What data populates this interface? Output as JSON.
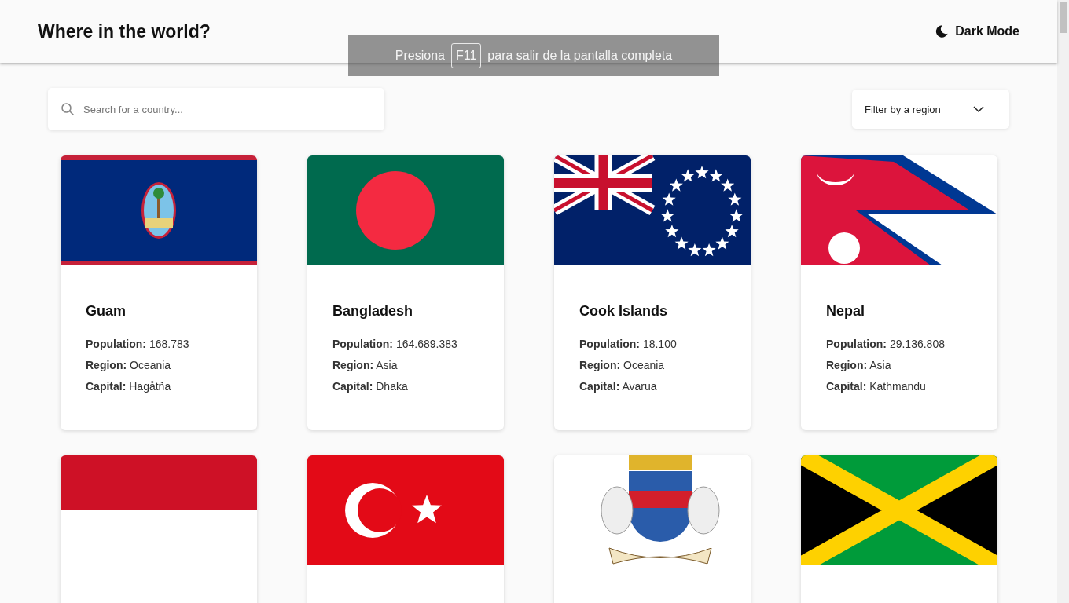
{
  "header": {
    "title": "Where in the world?",
    "theme_toggle": "Dark Mode"
  },
  "fullscreen_notice": {
    "before": "Presiona",
    "key": "F11",
    "after": "para salir de la pantalla completa"
  },
  "search": {
    "placeholder": "Search for a country..."
  },
  "region_filter": {
    "label": "Filter by a region"
  },
  "countries": [
    {
      "kind": "guam",
      "name": "Guam",
      "fields": [
        {
          "label": "Population:",
          "value": "168.783"
        },
        {
          "label": "Region:",
          "value": "Oceania"
        },
        {
          "label": "Capital:",
          "value": "Hagåtña"
        }
      ]
    },
    {
      "kind": "bangladesh",
      "name": "Bangladesh",
      "fields": [
        {
          "label": "Population:",
          "value": "164.689.383"
        },
        {
          "label": "Region:",
          "value": "Asia"
        },
        {
          "label": "Capital:",
          "value": "Dhaka"
        }
      ]
    },
    {
      "kind": "cook-islands",
      "name": "Cook Islands",
      "fields": [
        {
          "label": "Population:",
          "value": "18.100"
        },
        {
          "label": "Region:",
          "value": "Oceania"
        },
        {
          "label": "Capital:",
          "value": "Avarua"
        }
      ]
    },
    {
      "kind": "nepal",
      "name": "Nepal",
      "fields": [
        {
          "label": "Population:",
          "value": "29.136.808"
        },
        {
          "label": "Region:",
          "value": "Asia"
        },
        {
          "label": "Capital:",
          "value": "Kathmandu"
        }
      ]
    },
    {
      "kind": "red-white"
    },
    {
      "kind": "turkey"
    },
    {
      "kind": "coat-of-arms"
    },
    {
      "kind": "jamaica"
    }
  ]
}
